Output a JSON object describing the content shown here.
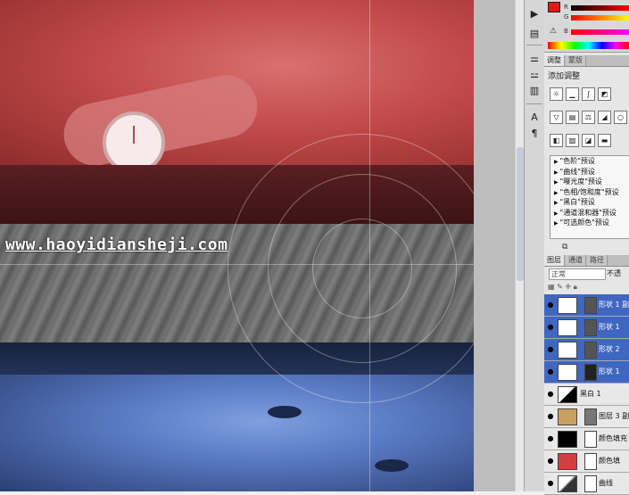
{
  "watermark": "www.haoyidiansheji.com",
  "colors": {
    "foreground": "#e01818",
    "selected_layer": "#3f67c2",
    "red_tint": "#c24a4a",
    "blue_tint": "#5879c2"
  },
  "color_panel": {
    "channels": [
      "R",
      "G",
      "B"
    ]
  },
  "adjustments_panel": {
    "tabs": [
      "调整",
      "蒙版"
    ],
    "title": "添加调整",
    "presets": [
      "\"色阶\"预设",
      "\"曲线\"预设",
      "\"曝光度\"预设",
      "\"色相/饱和度\"预设",
      "\"黑白\"预设",
      "\"通道混和器\"预设",
      "\"可选颜色\"预设"
    ]
  },
  "layers_panel": {
    "tabs": [
      "图层",
      "通道",
      "路径"
    ],
    "blend_mode": "正常",
    "opacity_label": "不透",
    "layers": [
      {
        "name": "形状 1 副",
        "selected": true
      },
      {
        "name": "形状 1",
        "selected": true
      },
      {
        "name": "形状 2",
        "selected": true
      },
      {
        "name": "形状 1",
        "selected": true
      },
      {
        "name": "黑白 1",
        "selected": false
      },
      {
        "name": "图层 3 副",
        "selected": false
      },
      {
        "name": "颜色填充",
        "selected": false
      },
      {
        "name": "颜色填",
        "selected": false
      },
      {
        "name": "曲线",
        "selected": false
      }
    ]
  }
}
